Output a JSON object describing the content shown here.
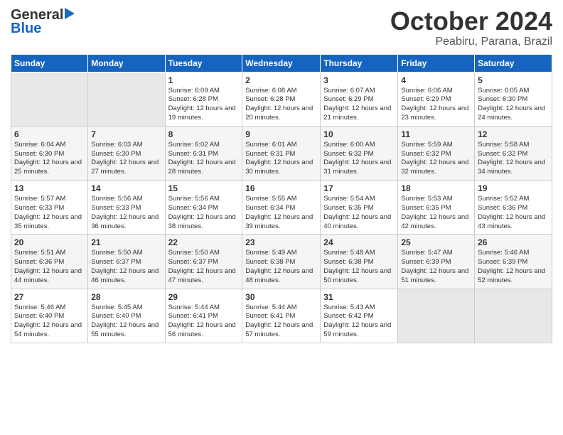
{
  "header": {
    "logo_general": "General",
    "logo_blue": "Blue",
    "title_month": "October 2024",
    "title_location": "Peabiru, Parana, Brazil"
  },
  "calendar": {
    "days_of_week": [
      "Sunday",
      "Monday",
      "Tuesday",
      "Wednesday",
      "Thursday",
      "Friday",
      "Saturday"
    ],
    "weeks": [
      [
        {
          "day": "",
          "sunrise": "",
          "sunset": "",
          "daylight": "",
          "empty": true
        },
        {
          "day": "",
          "sunrise": "",
          "sunset": "",
          "daylight": "",
          "empty": true
        },
        {
          "day": "1",
          "sunrise": "Sunrise: 6:09 AM",
          "sunset": "Sunset: 6:28 PM",
          "daylight": "Daylight: 12 hours and 19 minutes.",
          "empty": false
        },
        {
          "day": "2",
          "sunrise": "Sunrise: 6:08 AM",
          "sunset": "Sunset: 6:28 PM",
          "daylight": "Daylight: 12 hours and 20 minutes.",
          "empty": false
        },
        {
          "day": "3",
          "sunrise": "Sunrise: 6:07 AM",
          "sunset": "Sunset: 6:29 PM",
          "daylight": "Daylight: 12 hours and 21 minutes.",
          "empty": false
        },
        {
          "day": "4",
          "sunrise": "Sunrise: 6:06 AM",
          "sunset": "Sunset: 6:29 PM",
          "daylight": "Daylight: 12 hours and 23 minutes.",
          "empty": false
        },
        {
          "day": "5",
          "sunrise": "Sunrise: 6:05 AM",
          "sunset": "Sunset: 6:30 PM",
          "daylight": "Daylight: 12 hours and 24 minutes.",
          "empty": false
        }
      ],
      [
        {
          "day": "6",
          "sunrise": "Sunrise: 6:04 AM",
          "sunset": "Sunset: 6:30 PM",
          "daylight": "Daylight: 12 hours and 25 minutes.",
          "empty": false
        },
        {
          "day": "7",
          "sunrise": "Sunrise: 6:03 AM",
          "sunset": "Sunset: 6:30 PM",
          "daylight": "Daylight: 12 hours and 27 minutes.",
          "empty": false
        },
        {
          "day": "8",
          "sunrise": "Sunrise: 6:02 AM",
          "sunset": "Sunset: 6:31 PM",
          "daylight": "Daylight: 12 hours and 28 minutes.",
          "empty": false
        },
        {
          "day": "9",
          "sunrise": "Sunrise: 6:01 AM",
          "sunset": "Sunset: 6:31 PM",
          "daylight": "Daylight: 12 hours and 30 minutes.",
          "empty": false
        },
        {
          "day": "10",
          "sunrise": "Sunrise: 6:00 AM",
          "sunset": "Sunset: 6:32 PM",
          "daylight": "Daylight: 12 hours and 31 minutes.",
          "empty": false
        },
        {
          "day": "11",
          "sunrise": "Sunrise: 5:59 AM",
          "sunset": "Sunset: 6:32 PM",
          "daylight": "Daylight: 12 hours and 32 minutes.",
          "empty": false
        },
        {
          "day": "12",
          "sunrise": "Sunrise: 5:58 AM",
          "sunset": "Sunset: 6:32 PM",
          "daylight": "Daylight: 12 hours and 34 minutes.",
          "empty": false
        }
      ],
      [
        {
          "day": "13",
          "sunrise": "Sunrise: 5:57 AM",
          "sunset": "Sunset: 6:33 PM",
          "daylight": "Daylight: 12 hours and 35 minutes.",
          "empty": false
        },
        {
          "day": "14",
          "sunrise": "Sunrise: 5:56 AM",
          "sunset": "Sunset: 6:33 PM",
          "daylight": "Daylight: 12 hours and 36 minutes.",
          "empty": false
        },
        {
          "day": "15",
          "sunrise": "Sunrise: 5:56 AM",
          "sunset": "Sunset: 6:34 PM",
          "daylight": "Daylight: 12 hours and 38 minutes.",
          "empty": false
        },
        {
          "day": "16",
          "sunrise": "Sunrise: 5:55 AM",
          "sunset": "Sunset: 6:34 PM",
          "daylight": "Daylight: 12 hours and 39 minutes.",
          "empty": false
        },
        {
          "day": "17",
          "sunrise": "Sunrise: 5:54 AM",
          "sunset": "Sunset: 6:35 PM",
          "daylight": "Daylight: 12 hours and 40 minutes.",
          "empty": false
        },
        {
          "day": "18",
          "sunrise": "Sunrise: 5:53 AM",
          "sunset": "Sunset: 6:35 PM",
          "daylight": "Daylight: 12 hours and 42 minutes.",
          "empty": false
        },
        {
          "day": "19",
          "sunrise": "Sunrise: 5:52 AM",
          "sunset": "Sunset: 6:36 PM",
          "daylight": "Daylight: 12 hours and 43 minutes.",
          "empty": false
        }
      ],
      [
        {
          "day": "20",
          "sunrise": "Sunrise: 5:51 AM",
          "sunset": "Sunset: 6:36 PM",
          "daylight": "Daylight: 12 hours and 44 minutes.",
          "empty": false
        },
        {
          "day": "21",
          "sunrise": "Sunrise: 5:50 AM",
          "sunset": "Sunset: 6:37 PM",
          "daylight": "Daylight: 12 hours and 46 minutes.",
          "empty": false
        },
        {
          "day": "22",
          "sunrise": "Sunrise: 5:50 AM",
          "sunset": "Sunset: 6:37 PM",
          "daylight": "Daylight: 12 hours and 47 minutes.",
          "empty": false
        },
        {
          "day": "23",
          "sunrise": "Sunrise: 5:49 AM",
          "sunset": "Sunset: 6:38 PM",
          "daylight": "Daylight: 12 hours and 48 minutes.",
          "empty": false
        },
        {
          "day": "24",
          "sunrise": "Sunrise: 5:48 AM",
          "sunset": "Sunset: 6:38 PM",
          "daylight": "Daylight: 12 hours and 50 minutes.",
          "empty": false
        },
        {
          "day": "25",
          "sunrise": "Sunrise: 5:47 AM",
          "sunset": "Sunset: 6:39 PM",
          "daylight": "Daylight: 12 hours and 51 minutes.",
          "empty": false
        },
        {
          "day": "26",
          "sunrise": "Sunrise: 5:46 AM",
          "sunset": "Sunset: 6:39 PM",
          "daylight": "Daylight: 12 hours and 52 minutes.",
          "empty": false
        }
      ],
      [
        {
          "day": "27",
          "sunrise": "Sunrise: 5:46 AM",
          "sunset": "Sunset: 6:40 PM",
          "daylight": "Daylight: 12 hours and 54 minutes.",
          "empty": false
        },
        {
          "day": "28",
          "sunrise": "Sunrise: 5:45 AM",
          "sunset": "Sunset: 6:40 PM",
          "daylight": "Daylight: 12 hours and 55 minutes.",
          "empty": false
        },
        {
          "day": "29",
          "sunrise": "Sunrise: 5:44 AM",
          "sunset": "Sunset: 6:41 PM",
          "daylight": "Daylight: 12 hours and 56 minutes.",
          "empty": false
        },
        {
          "day": "30",
          "sunrise": "Sunrise: 5:44 AM",
          "sunset": "Sunset: 6:41 PM",
          "daylight": "Daylight: 12 hours and 57 minutes.",
          "empty": false
        },
        {
          "day": "31",
          "sunrise": "Sunrise: 5:43 AM",
          "sunset": "Sunset: 6:42 PM",
          "daylight": "Daylight: 12 hours and 59 minutes.",
          "empty": false
        },
        {
          "day": "",
          "sunrise": "",
          "sunset": "",
          "daylight": "",
          "empty": true
        },
        {
          "day": "",
          "sunrise": "",
          "sunset": "",
          "daylight": "",
          "empty": true
        }
      ]
    ]
  }
}
